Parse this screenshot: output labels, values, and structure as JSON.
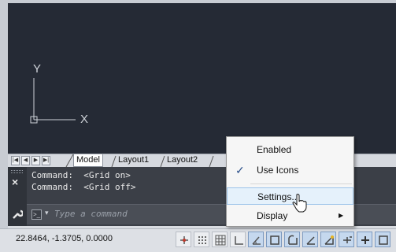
{
  "canvas": {
    "ucs": {
      "x_label": "X",
      "y_label": "Y"
    }
  },
  "layout_tabs": {
    "tabs": [
      "Model",
      "Layout1",
      "Layout2"
    ],
    "active": "Model"
  },
  "command_line": {
    "history": [
      "Command:  <Grid on>",
      "Command:  <Grid off>"
    ],
    "placeholder": "Type a command"
  },
  "status_bar": {
    "coordinates": "22.8464, -1.3705, 0.0000"
  },
  "context_menu": {
    "items": [
      {
        "label": "Enabled",
        "checked": false
      },
      {
        "label": "Use Icons",
        "checked": true
      },
      {
        "label": "Settings...",
        "highlighted": true
      },
      {
        "label": "Display",
        "has_submenu": true
      }
    ]
  },
  "colors": {
    "canvas_bg": "#252a35",
    "command_bg": "#3b3f47",
    "menu_highlight": "#e5f1fb",
    "active_toggle": "#c5d8ee"
  }
}
